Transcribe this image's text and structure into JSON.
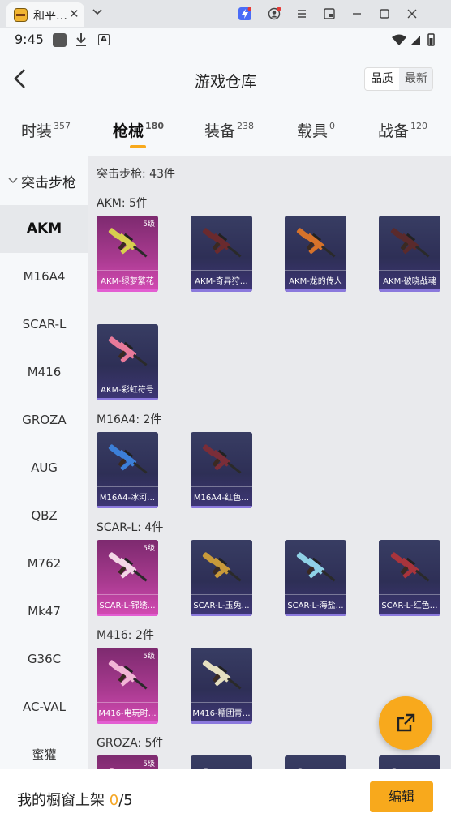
{
  "window": {
    "tab_title": "和平…",
    "icons": [
      "app-icon",
      "close-icon",
      "chevron-down-icon",
      "lightning-icon",
      "user-icon",
      "menu-icon",
      "picture-in-picture-icon",
      "minimize-icon",
      "maximize-icon",
      "close-icon"
    ]
  },
  "statusbar": {
    "time": "9:45"
  },
  "header": {
    "title": "游戏仓库",
    "sort_quality": "品质",
    "sort_newest": "最新"
  },
  "tabs": [
    {
      "label": "时装",
      "count": "357"
    },
    {
      "label": "枪械",
      "count": "180"
    },
    {
      "label": "装备",
      "count": "238"
    },
    {
      "label": "载具",
      "count": "0"
    },
    {
      "label": "战备",
      "count": "120"
    }
  ],
  "sidenav": {
    "category": "突击步枪",
    "items": [
      "AKM",
      "M16A4",
      "SCAR-L",
      "M416",
      "GROZA",
      "AUG",
      "QBZ",
      "M762",
      "Mk47",
      "G36C",
      "AC-VAL",
      "蜜獾"
    ]
  },
  "content": {
    "category_total": "突击步枪: 43件",
    "groups": [
      {
        "label": "AKM: 5件",
        "items": [
          {
            "name": "AKM-绿萝繁花",
            "level": "5级",
            "rarity": "pink",
            "gun_color": "#d7cf4e"
          },
          {
            "name": "AKM-奇异狩…",
            "level": "",
            "rarity": "std",
            "gun_color": "#6a2a2e"
          },
          {
            "name": "AKM-龙的传人",
            "level": "",
            "rarity": "std",
            "gun_color": "#d6722a"
          },
          {
            "name": "AKM-破晓战魂",
            "level": "",
            "rarity": "std",
            "gun_color": "#5a2a2c"
          },
          {
            "name": "AKM-彩虹符号",
            "level": "",
            "rarity": "std",
            "gun_color": "#e87a9a"
          }
        ]
      },
      {
        "label": "M16A4: 2件",
        "items": [
          {
            "name": "M16A4-冰河…",
            "level": "",
            "rarity": "std",
            "gun_color": "#3c7fd8"
          },
          {
            "name": "M16A4-红色…",
            "level": "",
            "rarity": "std",
            "gun_color": "#7a2d38"
          }
        ]
      },
      {
        "label": "SCAR-L: 4件",
        "items": [
          {
            "name": "SCAR-L-锦绣…",
            "level": "5级",
            "rarity": "pink",
            "gun_color": "#f3d6e6"
          },
          {
            "name": "SCAR-L-玉兔…",
            "level": "",
            "rarity": "std",
            "gun_color": "#c99a3a"
          },
          {
            "name": "SCAR-L-海盐…",
            "level": "",
            "rarity": "std",
            "gun_color": "#8fd1e6"
          },
          {
            "name": "SCAR-L-红色…",
            "level": "",
            "rarity": "std",
            "gun_color": "#a8343c"
          }
        ]
      },
      {
        "label": "M416: 2件",
        "items": [
          {
            "name": "M416-电玩时…",
            "level": "5级",
            "rarity": "pink",
            "gun_color": "#f2b6d6"
          },
          {
            "name": "M416-糯团青…",
            "level": "",
            "rarity": "std",
            "gun_color": "#e6e0c0"
          }
        ]
      },
      {
        "label": "GROZA: 5件",
        "items": [
          {
            "name": "",
            "level": "5级",
            "rarity": "pink",
            "gun_color": "#e0a0c8"
          },
          {
            "name": "",
            "level": "",
            "rarity": "std",
            "gun_color": "#8a8aa0"
          },
          {
            "name": "",
            "level": "",
            "rarity": "std",
            "gun_color": "#8a8aa0"
          },
          {
            "name": "",
            "level": "",
            "rarity": "std",
            "gun_color": "#8a8aa0"
          }
        ]
      }
    ]
  },
  "bottom": {
    "shelf_label": "我的橱窗上架",
    "shelf_current": "0",
    "shelf_total": "/5",
    "edit_label": "编辑"
  },
  "colors": {
    "accent": "#f8a91c",
    "pink_card": "#c440a4",
    "std_card": "#332f5c"
  }
}
